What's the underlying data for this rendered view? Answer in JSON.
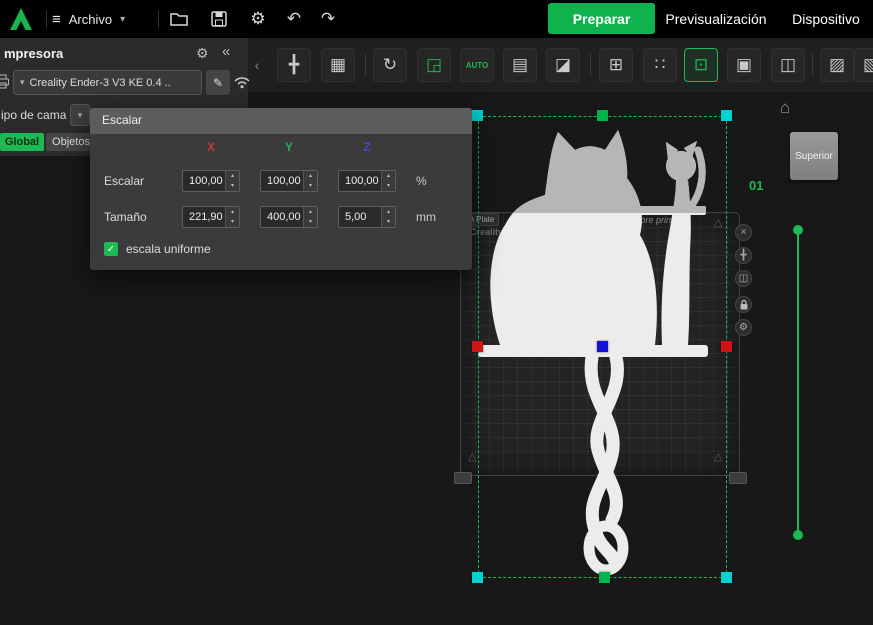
{
  "glyphs": {
    "menu": "≡",
    "chevron_down": "▾",
    "collapse": "«",
    "panel_collapse": "‹",
    "gear": "⚙",
    "undo": "↶",
    "redo": "↷",
    "pencil": "✎",
    "home": "⌂",
    "close": "×",
    "check": "✓",
    "spinner_up": "▴",
    "spinner_down": "▾",
    "move_gizmo": "╋",
    "mirror": "◫",
    "triangle": "△"
  },
  "topbar": {
    "menu_label": "Archivo",
    "views": [
      {
        "label": "Preparar",
        "active": true
      },
      {
        "label": "Previsualización",
        "active": false
      },
      {
        "label": "Dispositivo",
        "active": false
      }
    ]
  },
  "toolbar": {
    "tools": [
      {
        "name": "move",
        "glyph": "╋"
      },
      {
        "name": "transform",
        "glyph": "▦"
      },
      {
        "name": "rotate",
        "glyph": "↻"
      },
      {
        "name": "scale",
        "glyph": "◲"
      },
      {
        "name": "auto-orient",
        "glyph": "AUTO"
      },
      {
        "name": "plate-layout",
        "glyph": "▤"
      },
      {
        "name": "seam",
        "glyph": "◪"
      },
      {
        "name": "arrange",
        "glyph": "⊞"
      },
      {
        "name": "arrange-all",
        "glyph": "∷"
      },
      {
        "name": "fit-plate",
        "glyph": "⊡",
        "active": true
      },
      {
        "name": "stack",
        "glyph": "▣"
      },
      {
        "name": "clone",
        "glyph": "◫"
      },
      {
        "name": "hatch",
        "glyph": "▨"
      },
      {
        "name": "lattice",
        "glyph": "▧"
      }
    ]
  },
  "printer_panel": {
    "title": "mpresora",
    "printer_value": "Creality Ender-3 V3 KE 0.4 ..",
    "bed_label": "ipo de cama",
    "tabs": [
      {
        "label": "Global",
        "active": true
      },
      {
        "label": "Objetos",
        "active": false
      }
    ]
  },
  "scale_dialog": {
    "title": "Escalar",
    "axes": [
      {
        "label": "X",
        "color": "#c23b3b"
      },
      {
        "label": "Y",
        "color": "#2eae4e"
      },
      {
        "label": "Z",
        "color": "#4747d1"
      }
    ],
    "rows": [
      {
        "label": "Escalar",
        "unit": "%",
        "values": [
          "100,00",
          "100,00",
          "100,00"
        ]
      },
      {
        "label": "Tamaño",
        "unit": "mm",
        "values": [
          "221,90",
          "400,00",
          "5,00"
        ]
      }
    ],
    "uniform_label": "escala uniforme",
    "uniform_checked": true
  },
  "viewport": {
    "plate_tag": "A Plate",
    "plate_brand": "Creality S",
    "plate_note": "fore print ✎",
    "plate_number": "01",
    "view_label": "Superior"
  },
  "colors": {
    "accent": "#1db954",
    "prepare_button": "#0fb24c",
    "axis_x": "#c23b3b",
    "axis_y": "#2eae4e",
    "axis_z": "#4747d1",
    "handle_cyan": "#00d1d1",
    "handle_red": "#cf1212",
    "handle_blue": "#1212cf",
    "handle_green": "#00b34a"
  }
}
